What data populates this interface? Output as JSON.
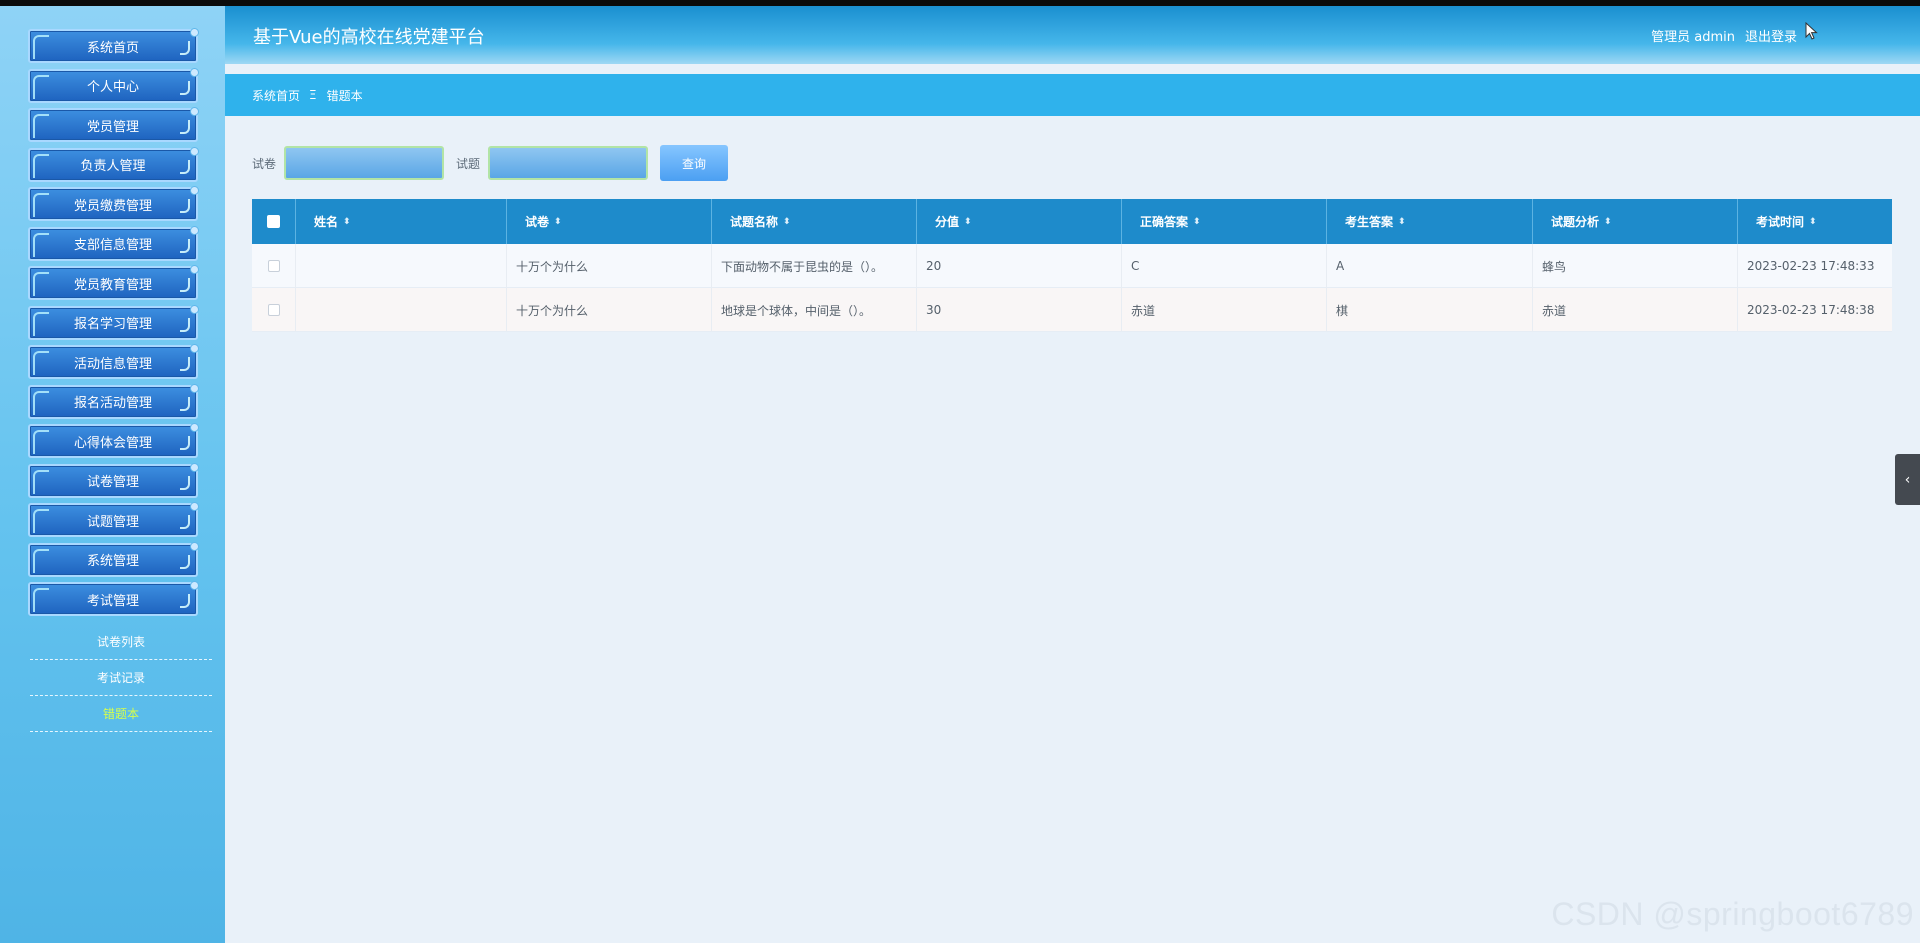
{
  "app": {
    "title": "基于Vue的高校在线党建平台",
    "user": "管理员 admin",
    "logout": "退出登录"
  },
  "sidebar": {
    "items": [
      {
        "label": "系统首页"
      },
      {
        "label": "个人中心"
      },
      {
        "label": "党员管理"
      },
      {
        "label": "负责人管理"
      },
      {
        "label": "党员缴费管理"
      },
      {
        "label": "支部信息管理"
      },
      {
        "label": "党员教育管理"
      },
      {
        "label": "报名学习管理"
      },
      {
        "label": "活动信息管理"
      },
      {
        "label": "报名活动管理"
      },
      {
        "label": "心得体会管理"
      },
      {
        "label": "试卷管理"
      },
      {
        "label": "试题管理"
      },
      {
        "label": "系统管理"
      },
      {
        "label": "考试管理"
      }
    ],
    "subitems": [
      {
        "label": "试卷列表"
      },
      {
        "label": "考试记录"
      },
      {
        "label": "错题本",
        "active": true
      }
    ]
  },
  "breadcrumb": {
    "home": "系统首页",
    "separator": "Ξ",
    "current": "错题本"
  },
  "search": {
    "paper_label": "试卷",
    "paper_value": "",
    "question_label": "试题",
    "question_value": "",
    "query_button": "查询"
  },
  "table": {
    "headers": [
      "姓名",
      "试卷",
      "试题名称",
      "分值",
      "正确答案",
      "考生答案",
      "试题分析",
      "考试时间"
    ],
    "rows": [
      {
        "name": "",
        "paper": "十万个为什么",
        "question": "下面动物不属于昆虫的是（）。",
        "score": "20",
        "correct": "C",
        "answer": "A",
        "analysis": "蜂鸟",
        "time": "2023-02-23 17:48:33"
      },
      {
        "name": "",
        "paper": "十万个为什么",
        "question": "地球是个球体，中间是（）。",
        "score": "30",
        "correct": "赤道",
        "answer": "棋",
        "analysis": "赤道",
        "time": "2023-02-23 17:48:38"
      }
    ]
  },
  "watermark": "CSDN @springboot6789",
  "colors": {
    "accent": "#2fb2ec",
    "table_header": "#1e8bcb",
    "active_sub": "#d8ff4a"
  }
}
